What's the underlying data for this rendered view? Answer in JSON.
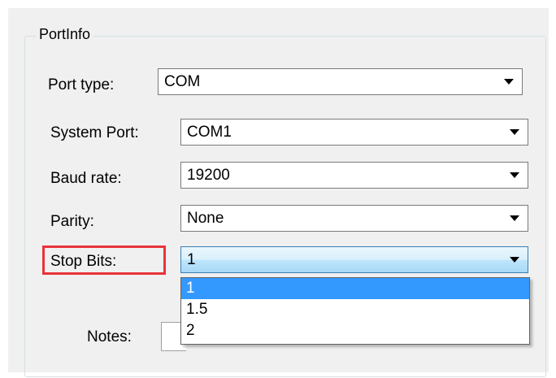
{
  "group": {
    "title": "PortInfo"
  },
  "fields": {
    "port_type": {
      "label": "Port type:",
      "value": "COM"
    },
    "system_port": {
      "label": "System Port:",
      "value": "COM1"
    },
    "baud_rate": {
      "label": "Baud rate:",
      "value": "19200"
    },
    "parity": {
      "label": "Parity:",
      "value": "None"
    },
    "stop_bits": {
      "label": "Stop Bits:",
      "value": "1",
      "options": [
        "1",
        "1.5",
        "2"
      ],
      "selected_index": 0
    },
    "notes": {
      "label": "Notes:"
    }
  },
  "colors": {
    "highlight_border": "#e8333a",
    "selection": "#3399ff",
    "panel_bg": "#f0f0f0"
  }
}
